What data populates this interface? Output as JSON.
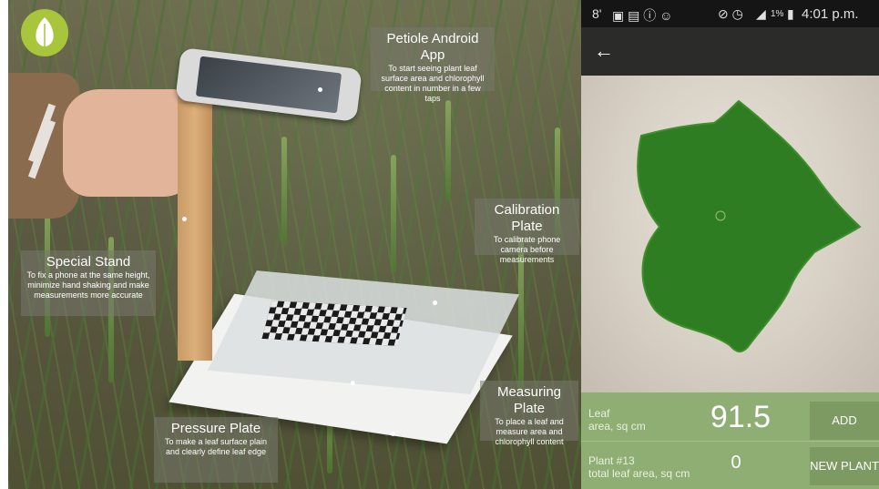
{
  "callouts": {
    "app": {
      "title": "Petiole Android App",
      "desc": "To start seeing plant leaf surface area and chlorophyll content in number in a few taps"
    },
    "calibration": {
      "title": "Calibration Plate",
      "desc": "To calibrate phone camera before measurements"
    },
    "stand": {
      "title": "Special Stand",
      "desc": "To fix a phone at the same height, minimize hand shaking and make measurements more accurate"
    },
    "measuring": {
      "title": "Measuring Plate",
      "desc": "To place a leaf and measure area and chlorophyll content"
    },
    "pressure": {
      "title": "Pressure Plate",
      "desc": "To make a leaf surface plain and clearly define leaf edge"
    }
  },
  "statusbar": {
    "notif_count": "8'",
    "battery": "1%",
    "time": "4:01 p.m."
  },
  "icons": {
    "back": "arrow-left-icon",
    "logo": "leaf-logo-icon"
  },
  "results": {
    "leaf": {
      "label1": "Leaf",
      "label2": "area, sq cm",
      "value": "91.5",
      "button": "ADD"
    },
    "plant": {
      "label1": "Plant #13",
      "label2": "total leaf area, sq cm",
      "value": "0",
      "button": "NEW PLANT"
    }
  },
  "colors": {
    "accent_green": "#8fae74",
    "button_green": "#7d9a62",
    "leaf_green": "#2f7d22",
    "logo_green": "#a8c53c"
  }
}
